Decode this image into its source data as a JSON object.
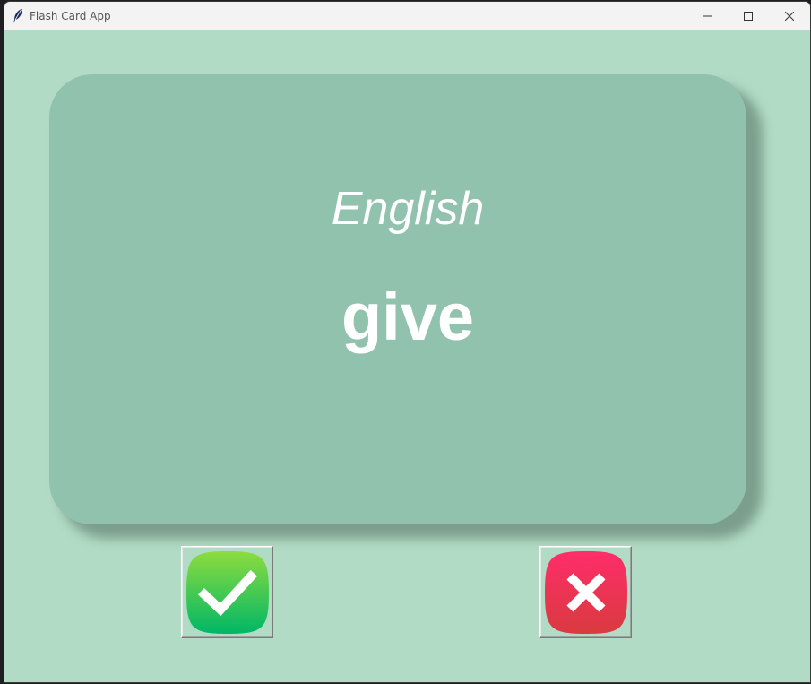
{
  "window": {
    "title": "Flash Card App",
    "icon": "feather-icon",
    "controls": [
      "minimize-icon",
      "maximize-icon",
      "close-icon"
    ]
  },
  "card": {
    "title": "English",
    "word": "give"
  },
  "buttons": {
    "right": {
      "icon": "checkmark-icon"
    },
    "wrong": {
      "icon": "cross-icon"
    }
  },
  "colors": {
    "background": "#b1dbc5",
    "card": "#91c2ae",
    "text": "#ffffff",
    "right_button": "#1fbf5c",
    "wrong_button": "#f23a5a"
  }
}
